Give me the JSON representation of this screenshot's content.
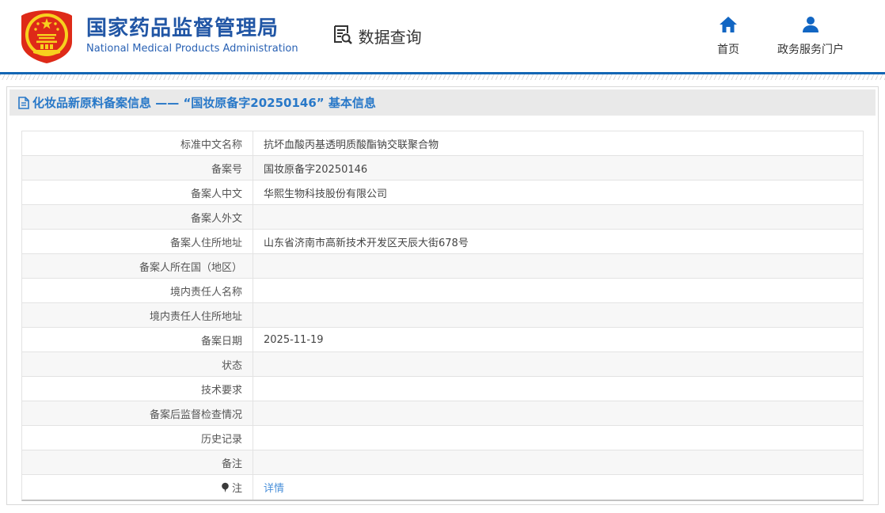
{
  "header": {
    "org_title": "国家药品监督管理局",
    "org_subtitle": "National Medical Products Administration",
    "section_label": "数据查询",
    "nav": [
      {
        "icon": "home-icon",
        "label": "首页"
      },
      {
        "icon": "user-icon",
        "label": "政务服务门户"
      }
    ]
  },
  "page": {
    "title": "化妆品新原料备案信息 —— “国妆原备字20250146” 基本信息"
  },
  "table": {
    "rows": [
      {
        "label": "标准中文名称",
        "value": "抗坏血酸丙基透明质酸酯钠交联聚合物"
      },
      {
        "label": "备案号",
        "value": "国妆原备字20250146"
      },
      {
        "label": "备案人中文",
        "value": "华熙生物科技股份有限公司"
      },
      {
        "label": "备案人外文",
        "value": ""
      },
      {
        "label": "备案人住所地址",
        "value": "山东省济南市高新技术开发区天辰大街678号"
      },
      {
        "label": "备案人所在国（地区）",
        "value": ""
      },
      {
        "label": "境内责任人名称",
        "value": ""
      },
      {
        "label": "境内责任人住所地址",
        "value": ""
      },
      {
        "label": "备案日期",
        "value": "2025-11-19"
      },
      {
        "label": "状态",
        "value": ""
      },
      {
        "label": "技术要求",
        "value": ""
      },
      {
        "label": "备案后监督检查情况",
        "value": ""
      },
      {
        "label": "历史记录",
        "value": ""
      },
      {
        "label": "备注",
        "value": ""
      },
      {
        "label": "注",
        "value": "详情",
        "link": true,
        "label_icon": "note-icon"
      }
    ]
  },
  "colors": {
    "header_blue": "#2156a5",
    "accent_blue": "#1366b4",
    "title_blue": "#2878c8",
    "link_blue": "#4a90da",
    "icon_blue": "#1266c3",
    "emblem_red": "#de2a18",
    "emblem_gold": "#f7d11e"
  }
}
